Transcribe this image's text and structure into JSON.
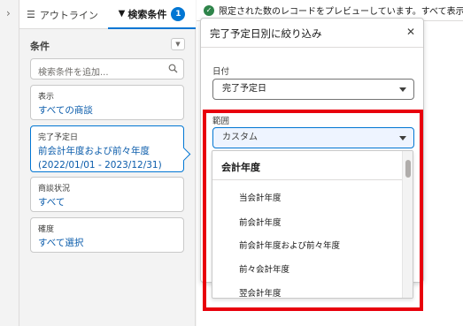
{
  "sidebar_tabs": {
    "outline_label": "アウトライン",
    "filters_label": "検索条件",
    "filters_count": "1"
  },
  "filters_panel": {
    "heading": "条件",
    "search_placeholder": "検索条件を追加...",
    "cards": [
      {
        "label": "表示",
        "value": "すべての商談"
      },
      {
        "label": "完了予定日",
        "value": "前会計年度および前々年度",
        "value2": "(2022/01/01 - 2023/12/31)"
      },
      {
        "label": "商談状況",
        "value": "すべて"
      },
      {
        "label": "確度",
        "value": "すべて選択"
      }
    ]
  },
  "notice": {
    "text": "限定された数のレコードをプレビューしています。すべて表示す"
  },
  "popover": {
    "title": "完了予定日別に絞り込み",
    "date_label": "日付",
    "date_value": "完了予定日",
    "range_label": "範囲",
    "range_value": "カスタム"
  },
  "range_dropdown": {
    "group_label": "会計年度",
    "options": [
      "当会計年度",
      "前会計年度",
      "前会計年度および前々年度",
      "前々会計年度",
      "翌会計年度"
    ]
  },
  "colors": {
    "accent": "#0176d3",
    "link": "#0b5cab",
    "highlight": "#e8000c",
    "success": "#2e844a"
  }
}
